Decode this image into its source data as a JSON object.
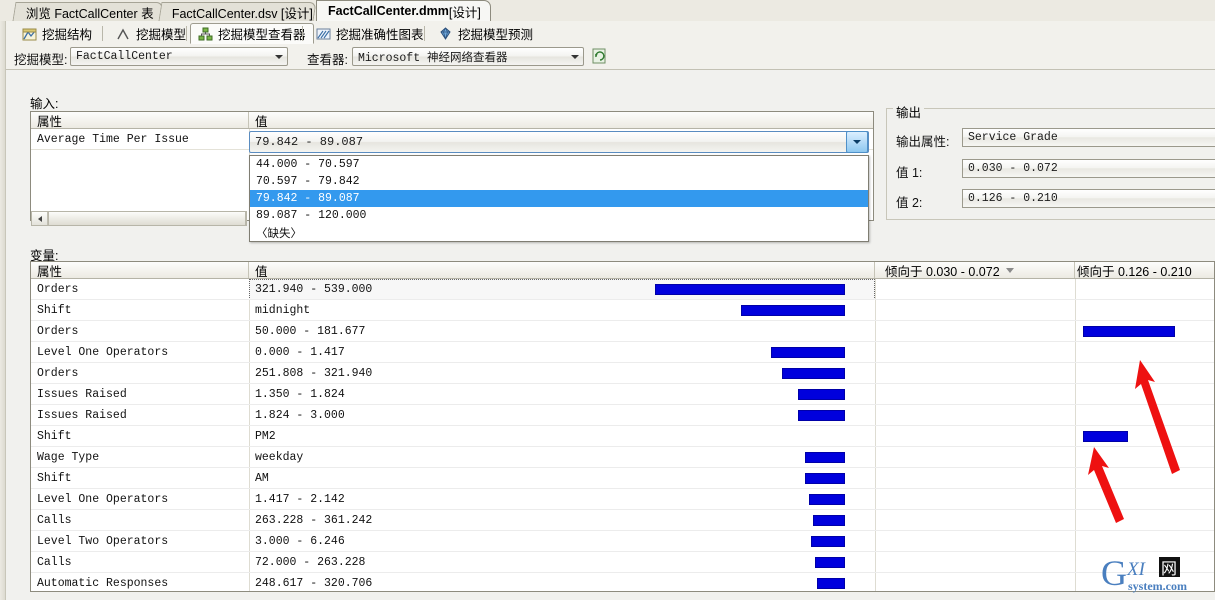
{
  "document_tabs": [
    {
      "label": "浏览 FactCallCenter 表",
      "active": false
    },
    {
      "label": "FactCallCenter.dsv [设计]",
      "active": false
    },
    {
      "label": "FactCallCenter.dmm",
      "suffix": " [设计]",
      "active": true
    }
  ],
  "viewer_tabs": [
    {
      "label": "挖掘结构",
      "icon": "mining-structure-icon",
      "selected": false
    },
    {
      "label": "挖掘模型",
      "icon": "mining-model-icon",
      "selected": false
    },
    {
      "label": "挖掘模型查看器",
      "icon": "mining-model-viewer-icon",
      "selected": true
    },
    {
      "label": "挖掘准确性图表",
      "icon": "accuracy-chart-icon",
      "selected": false
    },
    {
      "label": "挖掘模型预测",
      "icon": "prediction-diamond-icon",
      "selected": false
    }
  ],
  "selector_row": {
    "mining_model_label": "挖掘模型:",
    "mining_model_value": "FactCallCenter",
    "viewer_label": "查看器:",
    "viewer_value": "Microsoft 神经网络查看器",
    "refresh_icon": "refresh-icon"
  },
  "input_panel": {
    "title": "输入:",
    "columns": [
      "属性",
      "值"
    ],
    "rows": [
      {
        "attribute": "Average Time Per Issue",
        "value": "79.842 - 89.087"
      }
    ],
    "dropdown_open": true,
    "dropdown_options": [
      {
        "label": "44.000 - 70.597",
        "selected": false
      },
      {
        "label": "70.597 - 79.842",
        "selected": false
      },
      {
        "label": "79.842 - 89.087",
        "selected": true
      },
      {
        "label": "89.087 - 120.000",
        "selected": false
      },
      {
        "label": "〈缺失〉",
        "selected": false
      }
    ]
  },
  "output_panel": {
    "title": "输出",
    "attribute_label": "输出属性:",
    "attribute_value": "Service Grade",
    "value1_label": "值 1:",
    "value1": "0.030 - 0.072",
    "value2_label": "值 2:",
    "value2": "0.126 - 0.210"
  },
  "variables_panel": {
    "title": "变量:",
    "columns": [
      "属性",
      "值"
    ],
    "bar_column_1_header": "倾向于 0.030 - 0.072",
    "bar_column_1_sorted": true,
    "bar_column_2_header": "倾向于 0.126 - 0.210",
    "bar_color": "#0000dd",
    "rows": [
      {
        "attribute": "Orders",
        "value": "321.940 - 539.000",
        "bar1": 100,
        "bar2": 0,
        "focused": true
      },
      {
        "attribute": "Shift",
        "value": "midnight",
        "bar1": 55,
        "bar2": 0
      },
      {
        "attribute": "Orders",
        "value": "50.000 - 181.677",
        "bar1": 0,
        "bar2": 70
      },
      {
        "attribute": "Level One Operators",
        "value": "0.000 - 1.417",
        "bar1": 39,
        "bar2": 0
      },
      {
        "attribute": "Orders",
        "value": "251.808 - 321.940",
        "bar1": 33,
        "bar2": 0
      },
      {
        "attribute": "Issues Raised",
        "value": "1.350 - 1.824",
        "bar1": 25,
        "bar2": 0
      },
      {
        "attribute": "Issues Raised",
        "value": "1.824 - 3.000",
        "bar1": 25,
        "bar2": 0
      },
      {
        "attribute": "Shift",
        "value": "PM2",
        "bar1": 0,
        "bar2": 34
      },
      {
        "attribute": "Wage Type",
        "value": "weekday",
        "bar1": 21,
        "bar2": 0
      },
      {
        "attribute": "Shift",
        "value": "AM",
        "bar1": 21,
        "bar2": 0
      },
      {
        "attribute": "Level One Operators",
        "value": "1.417 - 2.142",
        "bar1": 19,
        "bar2": 0
      },
      {
        "attribute": "Calls",
        "value": "263.228 - 361.242",
        "bar1": 17,
        "bar2": 0
      },
      {
        "attribute": "Level Two Operators",
        "value": "3.000 - 6.246",
        "bar1": 18,
        "bar2": 0
      },
      {
        "attribute": "Calls",
        "value": "72.000 - 263.228",
        "bar1": 16,
        "bar2": 0
      },
      {
        "attribute": "Automatic Responses",
        "value": "248.617 - 320.706",
        "bar1": 15,
        "bar2": 0
      }
    ]
  },
  "annotations": {
    "arrow_color": "#ee1111",
    "arrow_count": 2
  },
  "watermark": {
    "letter": "G",
    "text": "XI网",
    "sub": "system.com",
    "color": "#4a7fbf"
  }
}
